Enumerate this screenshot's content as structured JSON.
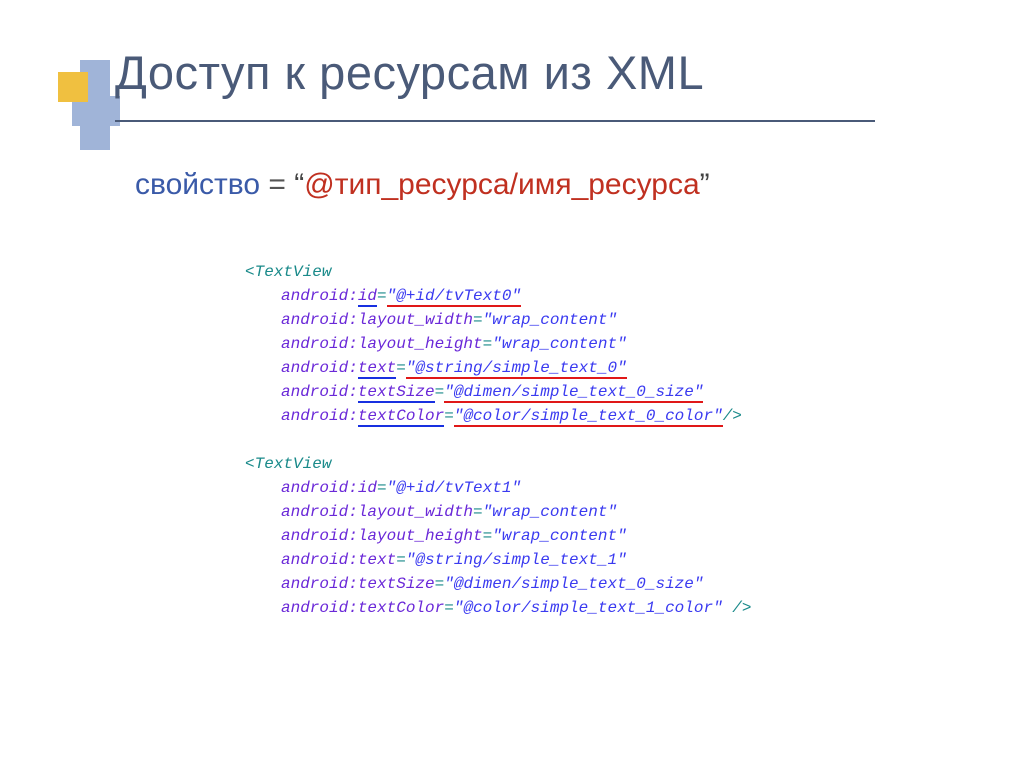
{
  "title": "Доступ к ресурсам из XML",
  "subtitle": {
    "prop": "свойство",
    "eq": " =  ",
    "q1": "“",
    "at": "@",
    "rtype": "тип_ресурса",
    "slash": "/",
    "rname": "имя_ресурса",
    "q2": "”"
  },
  "code1": {
    "tag": "<TextView",
    "l1_ns": "android:",
    "l1_attr": "id",
    "l1_val": "\"@+id/tvText0\"",
    "l2_ns": "android:",
    "l2_attr": "layout_width",
    "l2_val": "\"wrap_content\"",
    "l3_ns": "android:",
    "l3_attr": "layout_height",
    "l3_val": "\"wrap_content\"",
    "l4_ns": "android:",
    "l4_attr": "text",
    "l4_val": "\"@string/simple_text_0\"",
    "l5_ns": "android:",
    "l5_attr": "textSize",
    "l5_val": "\"@dimen/simple_text_0_size\"",
    "l6_ns": "android:",
    "l6_attr": "textColor",
    "l6_val": "\"@color/simple_text_0_color\"",
    "close": "/>"
  },
  "code2": {
    "tag": "<TextView",
    "l1_ns": "android:",
    "l1_attr": "id",
    "l1_val": "\"@+id/tvText1\"",
    "l2_ns": "android:",
    "l2_attr": "layout_width",
    "l2_val": "\"wrap_content\"",
    "l3_ns": "android:",
    "l3_attr": "layout_height",
    "l3_val": "\"wrap_content\"",
    "l4_ns": "android:",
    "l4_attr": "text",
    "l4_val": "\"@string/simple_text_1\"",
    "l5_ns": "android:",
    "l5_attr": "textSize",
    "l5_val": "\"@dimen/simple_text_0_size\"",
    "l6_ns": "android:",
    "l6_attr": "textColor",
    "l6_val": "\"@color/simple_text_1_color\"",
    "close": " />",
    "eq": "="
  },
  "eq": "="
}
